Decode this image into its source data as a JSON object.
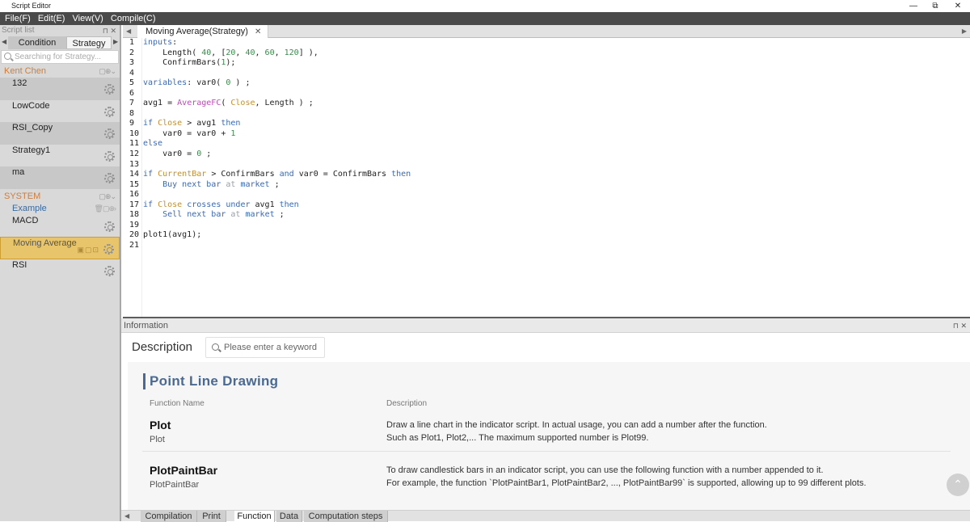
{
  "window": {
    "title": "Script Editor",
    "min": "—",
    "restore": "⧉",
    "close": "✕"
  },
  "menu": [
    "File(F)",
    "Edit(E)",
    "View(V)",
    "Compile(C)"
  ],
  "left_panel": {
    "title": "Script list",
    "tabs": [
      "Condition",
      "Strategy"
    ],
    "search_placeholder": "Searching for Strategy...",
    "groups": [
      {
        "name": "Kent Chen",
        "items": [
          "132",
          "LowCode",
          "RSI_Copy",
          "Strategy1",
          "ma"
        ]
      },
      {
        "name": "SYSTEM",
        "subgroup": "Example",
        "items": [
          "MACD",
          "Moving Average",
          "RSI"
        ]
      }
    ],
    "selected_item": "Moving Average"
  },
  "editor": {
    "tab_title": "Moving Average(Strategy)",
    "line_count": 21
  },
  "info_panel": {
    "title": "Information",
    "description_label": "Description",
    "search_placeholder": "Please enter a keyword",
    "section_title": "Point Line Drawing",
    "col_function": "Function Name",
    "col_description": "Description",
    "functions": [
      {
        "name": "Plot",
        "sub": "Plot",
        "desc1": "Draw a line chart in the indicator script. In actual usage, you can add a number after the function.",
        "desc2": "Such as Plot1, Plot2,... The maximum supported number is Plot99."
      },
      {
        "name": "PlotPaintBar",
        "sub": "PlotPaintBar",
        "desc1": "To draw candlestick bars in an indicator script, you can use the following function with a number appended to it.",
        "desc2": "For example, the function `PlotPaintBar1, PlotPaintBar2, ..., PlotPaintBar99` is supported, allowing up to 99 different plots."
      }
    ]
  },
  "bottom_tabs": [
    "Compilation",
    "Print",
    "Function",
    "Data",
    "Computation steps"
  ],
  "active_bottom_tab": "Function"
}
